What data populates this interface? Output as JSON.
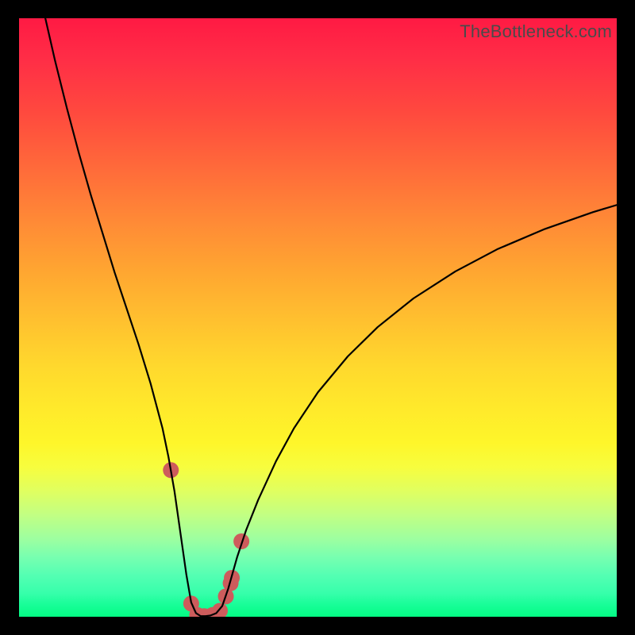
{
  "watermark": "TheBottleneck.com",
  "chart_data": {
    "type": "line",
    "title": "",
    "xlabel": "",
    "ylabel": "",
    "xlim": [
      0,
      100
    ],
    "ylim": [
      0,
      100
    ],
    "grid": false,
    "legend": false,
    "notes": "Bottleneck-style V curve over a vertical green→red gradient. Axes unlabeled. Values estimated from pixel positions.",
    "series": [
      {
        "name": "curve",
        "stroke": "#000000",
        "x": [
          4.4,
          6.0,
          8.0,
          10.0,
          12.0,
          14.0,
          16.0,
          18.0,
          20.0,
          22.0,
          24.0,
          25.0,
          26.0,
          27.0,
          28.0,
          28.8,
          29.6,
          30.4,
          31.2,
          32.0,
          33.0,
          34.0,
          35.0,
          36.5,
          38.0,
          40.0,
          43.0,
          46.0,
          50.0,
          55.0,
          60.0,
          66.0,
          73.0,
          80.0,
          88.0,
          96.0,
          100.0
        ],
        "y": [
          100.0,
          93.0,
          85.0,
          77.5,
          70.5,
          64.0,
          57.5,
          51.5,
          45.5,
          39.0,
          31.5,
          26.7,
          21.0,
          14.0,
          7.0,
          2.4,
          0.6,
          0.1,
          0.1,
          0.2,
          0.6,
          1.8,
          4.7,
          10.0,
          14.5,
          19.5,
          26.0,
          31.5,
          37.5,
          43.5,
          48.4,
          53.2,
          57.7,
          61.4,
          64.8,
          67.6,
          68.8
        ]
      }
    ],
    "markers": {
      "name": "points",
      "fill": "#cd5c5c",
      "radius": 10,
      "x": [
        25.4,
        28.8,
        29.8,
        31.0,
        32.4,
        33.6,
        34.6,
        35.4,
        35.6,
        37.2
      ],
      "y": [
        24.5,
        2.2,
        0.3,
        0.1,
        0.3,
        1.0,
        3.4,
        5.6,
        6.5,
        12.6
      ]
    }
  }
}
